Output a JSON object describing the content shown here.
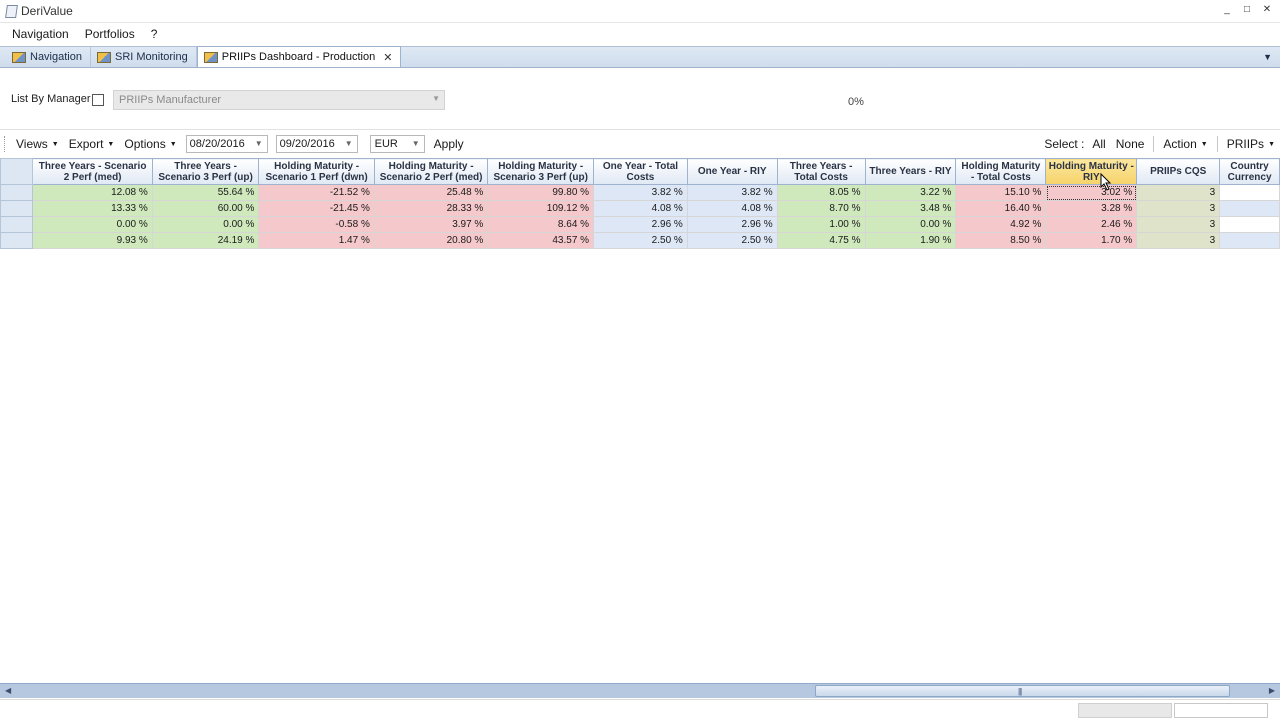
{
  "window": {
    "title": "DeriValue",
    "controls": [
      "_",
      "□",
      "✕"
    ]
  },
  "menu": {
    "items": [
      "Navigation",
      "Portfolios",
      "?"
    ]
  },
  "tabs": [
    {
      "label": "Navigation",
      "active": false
    },
    {
      "label": "SRI Monitoring",
      "active": false
    },
    {
      "label": "PRIIPs Dashboard - Production",
      "active": true,
      "close": "✕"
    }
  ],
  "filter": {
    "list_by_manager_label": "List By Manager",
    "list_by_manager_checked": false,
    "manufacturer_placeholder": "PRIIPs Manufacturer",
    "progress_text": "0%"
  },
  "toolbar": {
    "views": "Views",
    "export": "Export",
    "options": "Options",
    "date_from": "08/20/2016",
    "date_to": "09/20/2016",
    "currency": "EUR",
    "apply": "Apply",
    "select_label": "Select :",
    "select_all": "All",
    "select_none": "None",
    "action": "Action",
    "priips": "PRIIPs"
  },
  "grid": {
    "columns": [
      "Three Years - Scenario 2 Perf (med)",
      "Three Years - Scenario 3 Perf (up)",
      "Holding Maturity - Scenario 1 Perf (dwn)",
      "Holding Maturity - Scenario 2 Perf (med)",
      "Holding Maturity - Scenario 3 Perf (up)",
      "One Year - Total Costs",
      "One Year - RIY",
      "Three Years - Total Costs",
      "Three Years - RIY",
      "Holding Maturity - Total Costs",
      "Holding Maturity - RIY",
      "PRIIPs CQS",
      "Country Currency"
    ],
    "rows": [
      [
        "12.08 %",
        "55.64 %",
        "-21.52 %",
        "25.48 %",
        "99.80 %",
        "3.82 %",
        "3.82 %",
        "8.05 %",
        "3.22 %",
        "15.10 %",
        "3.02 %",
        "3",
        ""
      ],
      [
        "13.33 %",
        "60.00 %",
        "-21.45 %",
        "28.33 %",
        "109.12 %",
        "4.08 %",
        "4.08 %",
        "8.70 %",
        "3.48 %",
        "16.40 %",
        "3.28 %",
        "3",
        ""
      ],
      [
        "0.00 %",
        "0.00 %",
        "-0.58 %",
        "3.97 %",
        "8.64 %",
        "2.96 %",
        "2.96 %",
        "1.00 %",
        "0.00 %",
        "4.92 %",
        "2.46 %",
        "3",
        ""
      ],
      [
        "9.93 %",
        "24.19 %",
        "1.47 %",
        "20.80 %",
        "43.57 %",
        "2.50 %",
        "2.50 %",
        "4.75 %",
        "1.90 %",
        "8.50 %",
        "1.70 %",
        "3",
        ""
      ]
    ],
    "row_colors": [
      [
        "g",
        "g",
        "r",
        "r",
        "r",
        "b",
        "b",
        "g",
        "g",
        "r",
        "r",
        "y",
        "w"
      ],
      [
        "g",
        "g",
        "r",
        "r",
        "r",
        "b",
        "b",
        "g",
        "g",
        "r",
        "r",
        "y",
        "b"
      ],
      [
        "g",
        "g",
        "r",
        "r",
        "r",
        "b",
        "b",
        "g",
        "g",
        "r",
        "r",
        "y",
        "w"
      ],
      [
        "g",
        "g",
        "r",
        "r",
        "r",
        "b",
        "b",
        "g",
        "g",
        "r",
        "r",
        "y",
        "b"
      ]
    ],
    "selected_column": "Holding Maturity - RIY",
    "colors": {
      "green": "#cfe9bd",
      "red": "#f5c9cc",
      "blue": "#dde7f5",
      "olive": "#dfe3c9"
    }
  }
}
